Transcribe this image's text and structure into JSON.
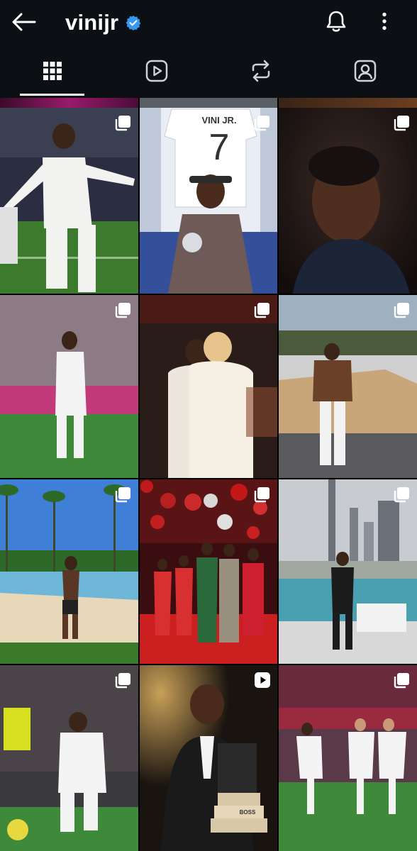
{
  "header": {
    "username": "vinijr",
    "back_icon": "back-arrow-icon",
    "verified_icon": "verified-badge-icon",
    "bell_icon": "bell-icon",
    "more_icon": "more-vertical-icon"
  },
  "tabs": [
    {
      "name": "posts",
      "icon": "grid-icon",
      "active": true
    },
    {
      "name": "reels",
      "icon": "reels-icon",
      "active": false
    },
    {
      "name": "reposts",
      "icon": "repost-icon",
      "active": false
    },
    {
      "name": "tagged",
      "icon": "tagged-icon",
      "active": false
    }
  ],
  "posts": [
    {
      "badge": "carousel-icon"
    },
    {
      "badge": "carousel-icon",
      "jersey_name": "VINI JR.",
      "jersey_number": "7"
    },
    {
      "badge": "carousel-icon"
    },
    {
      "badge": "carousel-icon"
    },
    {
      "badge": "carousel-icon"
    },
    {
      "badge": "carousel-icon"
    },
    {
      "badge": "carousel-icon"
    },
    {
      "badge": "carousel-icon"
    },
    {
      "badge": "carousel-icon"
    },
    {
      "badge": "carousel-icon"
    },
    {
      "badge": "reel-icon",
      "award_text": "BOSS"
    },
    {
      "badge": "carousel-icon"
    }
  ],
  "colors": {
    "header_bg": "#0c0f14",
    "verified_blue": "#3897f0",
    "active_underline": "#ffffff"
  }
}
